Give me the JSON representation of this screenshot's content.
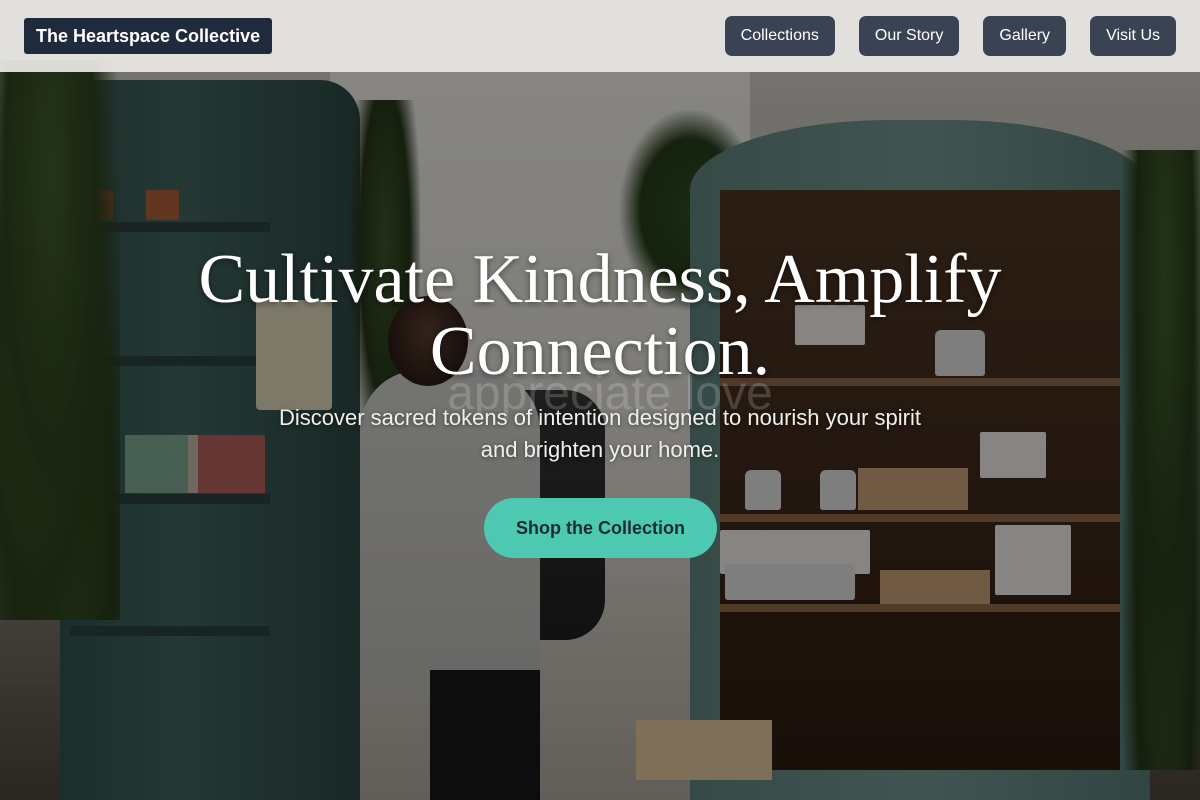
{
  "header": {
    "brand": "The Heartspace Collective",
    "nav": [
      {
        "label": "Collections"
      },
      {
        "label": "Our Story"
      },
      {
        "label": "Gallery"
      },
      {
        "label": "Visit Us"
      }
    ]
  },
  "hero": {
    "title": "Cultivate Kindness, Amplify Connection.",
    "watermark": "appreciate love",
    "subtitle": "Discover sacred tokens of intention designed to nourish your spirit and brighten your home.",
    "cta_label": "Shop the Collection",
    "image": "photo of a person browsing a plant-filled shop with green cabinets of candles and jars"
  },
  "colors": {
    "brand_bg": "#1f2a3c",
    "nav_bg": "#3a4353",
    "cta_bg": "#4cc9b0",
    "cta_text": "#1b2a33",
    "header_bg": "#e9e8e5"
  }
}
